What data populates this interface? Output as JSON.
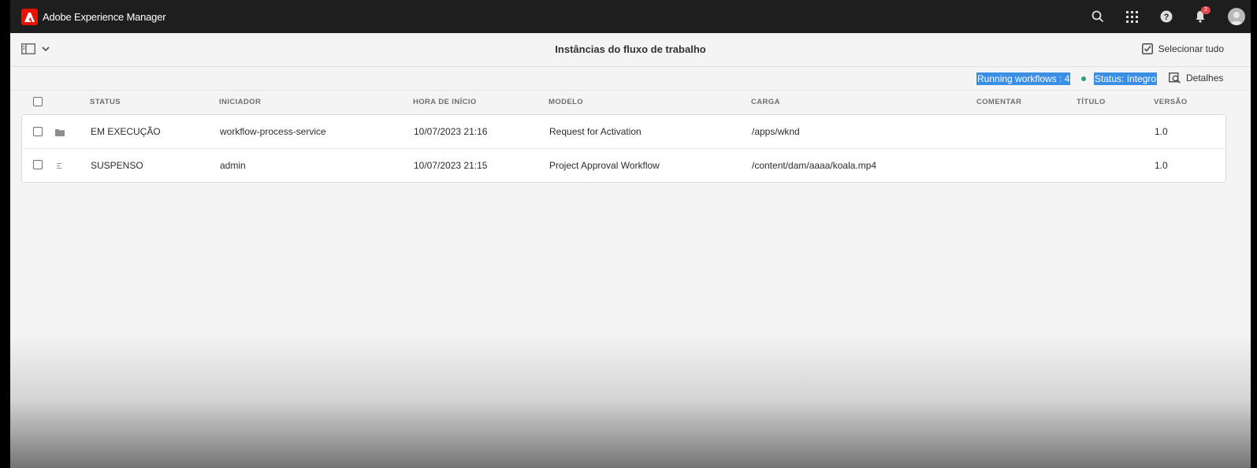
{
  "shell": {
    "brand_name": "Adobe Experience Manager",
    "notification_count": "2",
    "icons": [
      "adobe-logo-icon",
      "search-icon",
      "apps-grid-icon",
      "help-icon",
      "bell-icon",
      "user-avatar-icon"
    ]
  },
  "action_bar": {
    "page_title": "Instâncias do fluxo de trabalho",
    "select_all_label": "Selecionar tudo"
  },
  "status_bar": {
    "running_workflows": "Running workflows : 4",
    "health_status": "Status: íntegro",
    "details_label": "Detalhes",
    "health_color": "#2d9d78",
    "selection_color": "#3a8ee6"
  },
  "table": {
    "columns": [
      "STATUS",
      "INICIADOR",
      "HORA DE INÍCIO",
      "MODELO",
      "CARGA",
      "COMENTAR",
      "TÍTULO",
      "VERSÃO"
    ],
    "rows": [
      {
        "icon": "folder-icon",
        "status": "EM EXECUÇÃO",
        "initiator": "workflow-process-service",
        "start_time": "10/07/2023 21:16",
        "model": "Request for Activation",
        "payload": "/apps/wknd",
        "comment": "",
        "title": "",
        "version": "1.0"
      },
      {
        "icon": "document-icon",
        "status": "SUSPENSO",
        "initiator": "admin",
        "start_time": "10/07/2023 21:15",
        "model": "Project Approval Workflow",
        "payload": "/content/dam/aaaa/koala.mp4",
        "comment": "",
        "title": "",
        "version": "1.0"
      }
    ]
  }
}
